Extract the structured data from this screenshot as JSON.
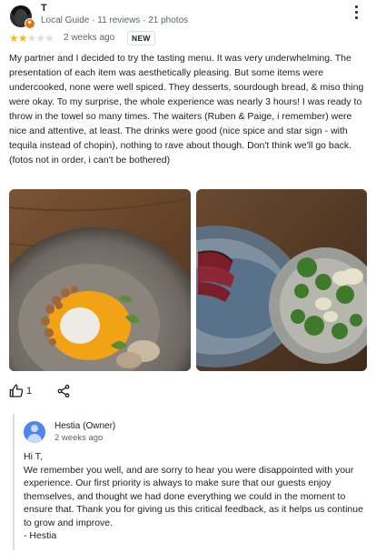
{
  "review": {
    "author_name": "T",
    "author_meta": "Local Guide · 11 reviews · 21 photos",
    "rating": 2,
    "max_rating": 5,
    "date": "2 weeks ago",
    "badge": "NEW",
    "text": "My partner and I decided to try the tasting menu. It was very underwhelming. The presentation of each item was aesthetically pleasing. But some items were undercooked, none were well spiced. They desserts, sourdough bread, & miso thing were okay. To my surprise, the whole experience was nearly 3 hours! I was ready to throw in the towel so many times. The waiters (Ruben & Paige, i remember) were nice and attentive, at least. The drinks were good (nice spice and star sign - with tequila instead of chopin), nothing to rave about though. Don't think we'll go back. (fotos not in order, i can't be bothered)",
    "like_count": "1",
    "icons": {
      "more": "more-vert-icon",
      "like": "thumbs-up-icon",
      "share": "share-icon",
      "local_guide": "local-guide-badge-icon"
    },
    "colors": {
      "star_on": "#fbbc04",
      "star_off": "#dadce0",
      "local_guide_badge": "#e8710a"
    }
  },
  "owner_response": {
    "name": "Hestia (Owner)",
    "date": "2 weeks ago",
    "greeting": "Hi T,",
    "body": "We remember you well, and are sorry to hear you were disappointed with your experience. Our first priority is always to make sure that our guests enjoy themselves, and thought we had done everything we could in the moment to ensure that. Thank you for giving us this critical feedback, as it helps us continue to grow and improve.",
    "signature": "- Hestia",
    "avatar_color": "#4f86ec"
  }
}
